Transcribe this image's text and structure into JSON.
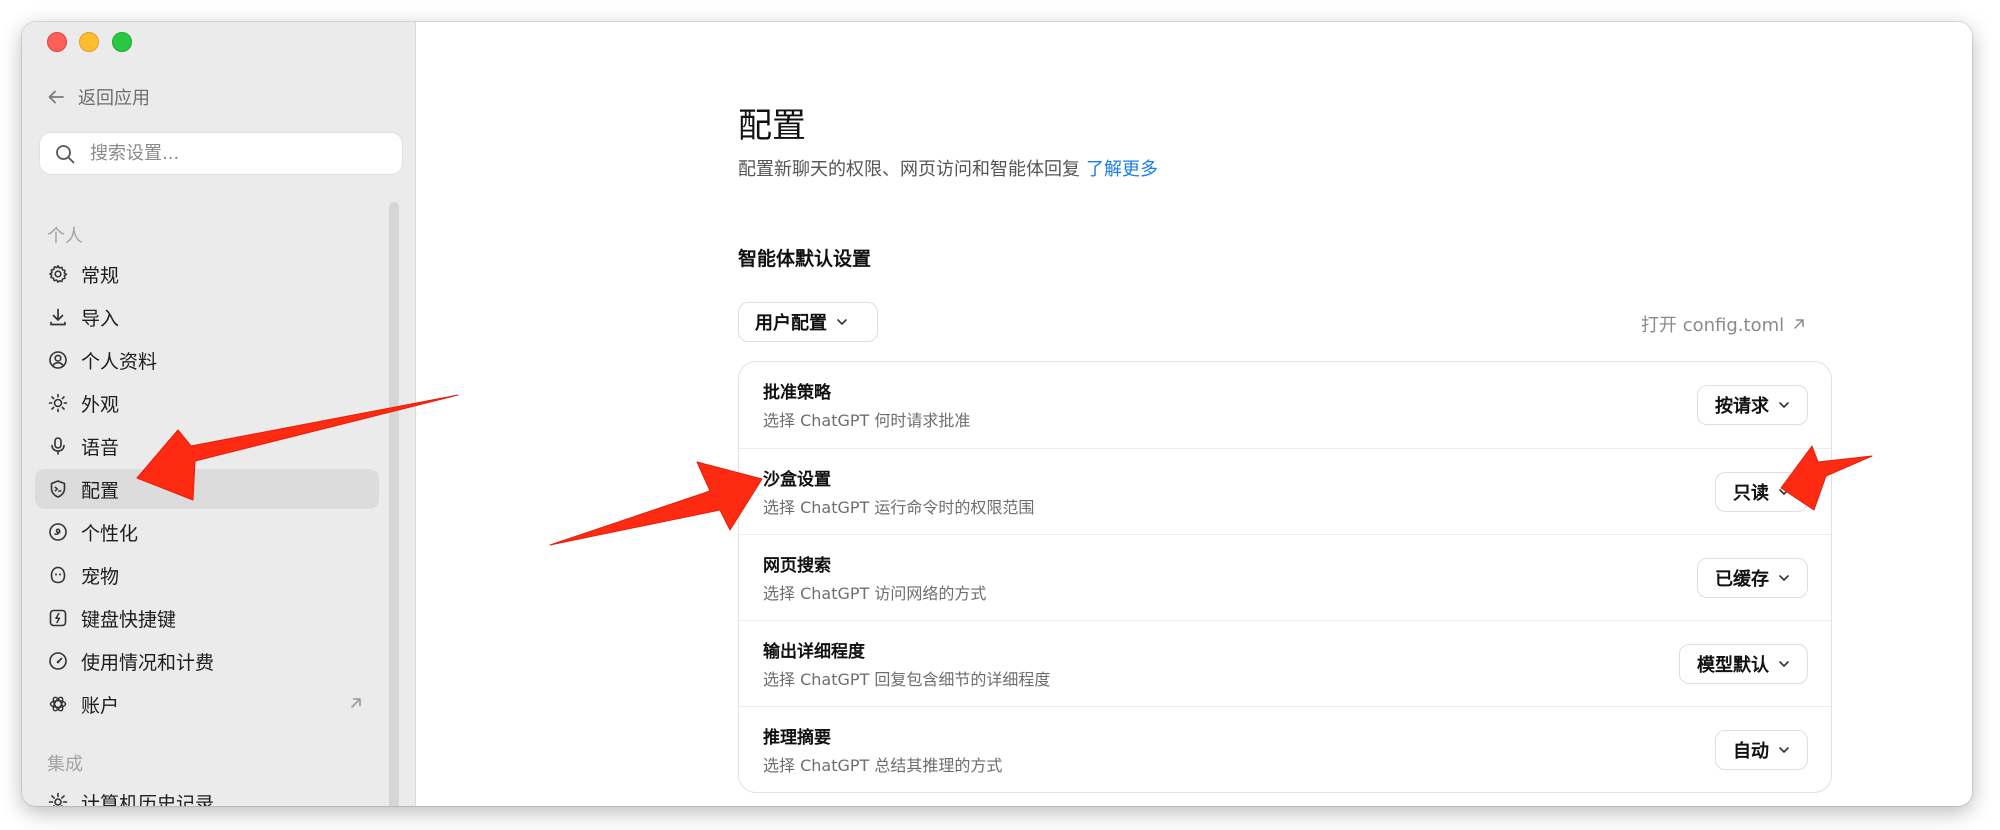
{
  "sidebar": {
    "back_label": "返回应用",
    "search_placeholder": "搜索设置...",
    "section_personal": "个人",
    "items": [
      {
        "label": "常规",
        "icon": "gear-icon"
      },
      {
        "label": "导入",
        "icon": "download-icon"
      },
      {
        "label": "个人资料",
        "icon": "profile-icon"
      },
      {
        "label": "外观",
        "icon": "sun-icon"
      },
      {
        "label": "语音",
        "icon": "microphone-icon"
      },
      {
        "label": "配置",
        "icon": "shield-icon",
        "active": true
      },
      {
        "label": "个性化",
        "icon": "personalize-icon"
      },
      {
        "label": "宠物",
        "icon": "pet-icon"
      },
      {
        "label": "键盘快捷键",
        "icon": "keyboard-icon"
      },
      {
        "label": "使用情况和计费",
        "icon": "gauge-icon"
      },
      {
        "label": "账户",
        "icon": "openai-icon",
        "external": true
      }
    ],
    "section_integration": "集成",
    "integration_items": [
      {
        "label": "计算机历史记录",
        "icon": "history-icon"
      }
    ]
  },
  "main": {
    "title": "配置",
    "subtitle": "配置新聊天的权限、网页访问和智能体回复",
    "learn_more": "了解更多",
    "section_title": "智能体默认设置",
    "profile_select": "用户配置",
    "open_config": "打开 config.toml",
    "settings": [
      {
        "title": "批准策略",
        "desc": "选择 ChatGPT 何时请求批准",
        "value": "按请求"
      },
      {
        "title": "沙盒设置",
        "desc": "选择 ChatGPT 运行命令时的权限范围",
        "value": "只读"
      },
      {
        "title": "网页搜索",
        "desc": "选择 ChatGPT 访问网络的方式",
        "value": "已缓存"
      },
      {
        "title": "输出详细程度",
        "desc": "选择 ChatGPT 回复包含细节的详细程度",
        "value": "模型默认"
      },
      {
        "title": "推理摘要",
        "desc": "选择 ChatGPT 总结其推理的方式",
        "value": "自动"
      }
    ]
  },
  "colors": {
    "accent_link": "#1a7df0",
    "annotation_arrow": "#ff2a12",
    "sidebar_bg": "#ebebeb",
    "active_item_bg": "#dcdcdc"
  }
}
